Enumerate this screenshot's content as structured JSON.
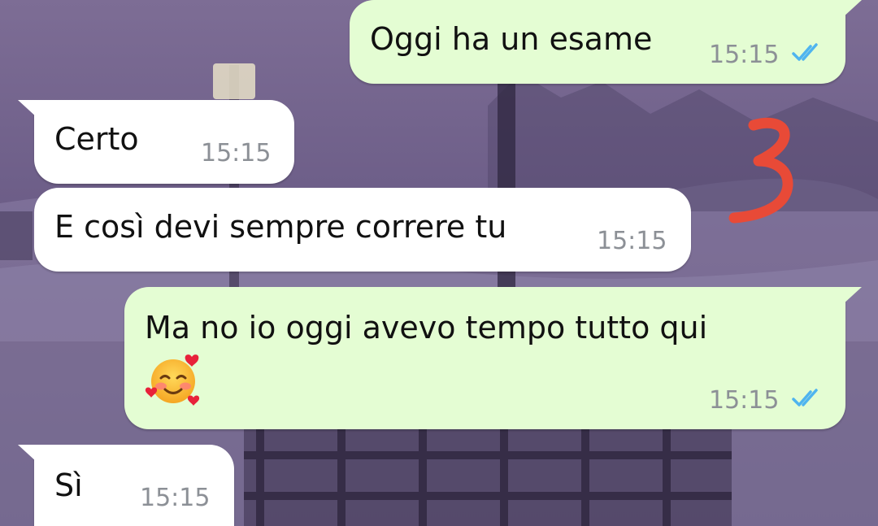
{
  "chat": {
    "annotation_mark": "3",
    "colors": {
      "outgoing_bubble": "#e4fdd3",
      "incoming_bubble": "#ffffff",
      "read_ticks": "#4fb4ef",
      "timestamp": "#8c9096",
      "annotation": "#e84a37"
    },
    "messages": [
      {
        "direction": "outgoing",
        "text": "Oggi ha un esame",
        "time": "15:15",
        "status_icon": "double-check-read"
      },
      {
        "direction": "incoming",
        "text": "Certo",
        "time": "15:15"
      },
      {
        "direction": "incoming",
        "text": "E così devi sempre correre tu",
        "time": "15:15"
      },
      {
        "direction": "outgoing",
        "text": "Ma no io oggi avevo tempo tutto qui",
        "emoji": "smiling-face-with-hearts",
        "time": "15:15",
        "status_icon": "double-check-read"
      },
      {
        "direction": "incoming",
        "text": "Sì",
        "time": "15:15"
      }
    ]
  }
}
